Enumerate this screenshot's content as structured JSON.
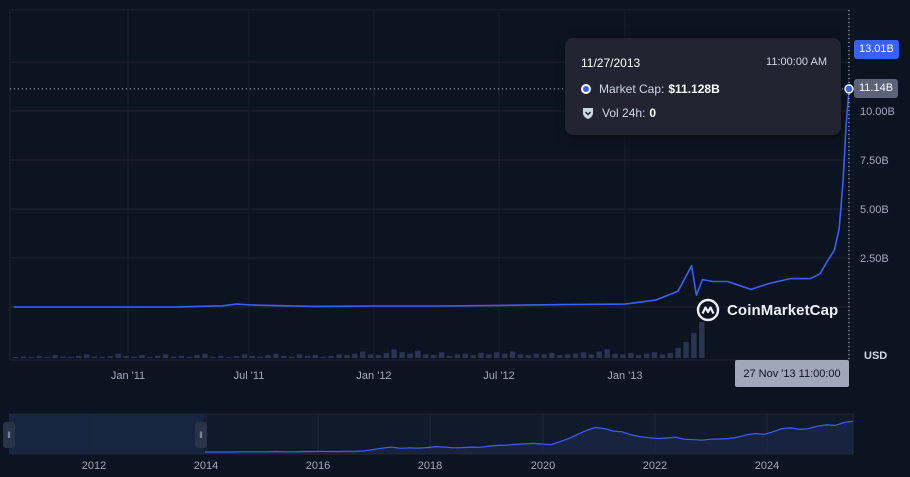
{
  "chart_data": {
    "type": "line",
    "title": "",
    "xlabel": "",
    "ylabel": "",
    "currency_label": "USD",
    "y_axis": {
      "ticks": [
        "2.50B",
        "5.00B",
        "7.50B",
        "10.00B"
      ],
      "tick_values": [
        2.5,
        5.0,
        7.5,
        10.0
      ],
      "unit": "B"
    },
    "x_axis_labels": [
      "Jan '11",
      "Jul '11",
      "Jan '12",
      "Jul '12",
      "Jan '13"
    ],
    "series": [
      {
        "name": "Market Cap",
        "unit": "B USD",
        "x": [
          "2010-07-17",
          "2010-10-01",
          "2011-01-01",
          "2011-03-15",
          "2011-05-20",
          "2011-06-10",
          "2011-07-01",
          "2011-10-01",
          "2012-01-01",
          "2012-04-01",
          "2012-07-01",
          "2012-10-01",
          "2013-01-01",
          "2013-02-15",
          "2013-03-20",
          "2013-04-09",
          "2013-04-16",
          "2013-04-25",
          "2013-05-10",
          "2013-06-01",
          "2013-07-05",
          "2013-08-01",
          "2013-09-01",
          "2013-10-01",
          "2013-10-15",
          "2013-10-25",
          "2013-11-05",
          "2013-11-12",
          "2013-11-18",
          "2013-11-22",
          "2013-11-27"
        ],
        "values": [
          0.0,
          0.001,
          0.002,
          0.006,
          0.06,
          0.15,
          0.1,
          0.03,
          0.05,
          0.05,
          0.08,
          0.12,
          0.15,
          0.35,
          0.8,
          2.1,
          0.6,
          1.4,
          1.3,
          1.3,
          0.9,
          1.2,
          1.45,
          1.45,
          1.7,
          2.3,
          2.9,
          4.0,
          6.5,
          9.2,
          11.128
        ]
      }
    ],
    "volume_24h": {
      "name": "Vol 24h",
      "values": [
        0.005,
        0.02,
        0.01,
        0.03,
        0.015,
        0.04,
        0.02,
        0.01,
        0.03,
        0.05,
        0.02,
        0.01,
        0.025,
        0.06,
        0.03,
        0.02,
        0.04,
        0.01,
        0.03,
        0.05,
        0.02,
        0.03,
        0.015,
        0.04,
        0.06,
        0.02,
        0.03,
        0.01,
        0.025,
        0.05,
        0.03,
        0.02,
        0.04,
        0.06,
        0.03,
        0.02,
        0.05,
        0.03,
        0.04,
        0.02,
        0.03,
        0.05,
        0.04,
        0.06,
        0.09,
        0.05,
        0.04,
        0.07,
        0.12,
        0.08,
        0.06,
        0.1,
        0.05,
        0.04,
        0.08,
        0.03,
        0.05,
        0.06,
        0.04,
        0.07,
        0.05,
        0.08,
        0.06,
        0.09,
        0.05,
        0.04,
        0.06,
        0.05,
        0.07,
        0.04,
        0.05,
        0.06,
        0.08,
        0.05,
        0.09,
        0.12,
        0.06,
        0.05,
        0.07,
        0.04,
        0.06,
        0.08,
        0.05,
        0.07,
        0.14,
        0.22,
        0.35,
        0.5
      ]
    },
    "navigator": {
      "x_labels": [
        "2012",
        "2014",
        "2016",
        "2018",
        "2020",
        "2022",
        "2024"
      ],
      "values": [
        0.0,
        0.0,
        0.0,
        0.0,
        0.01,
        0.01,
        0.01,
        0.01,
        0.02,
        0.01,
        0.01,
        0.02,
        0.02,
        0.03,
        0.02,
        0.02,
        0.03,
        0.03,
        0.05,
        0.1,
        0.16,
        0.2,
        0.15,
        0.17,
        0.16,
        0.18,
        0.22,
        0.2,
        0.17,
        0.18,
        0.2,
        0.19,
        0.24,
        0.27,
        0.28,
        0.31,
        0.33,
        0.35,
        0.32,
        0.3,
        0.42,
        0.55,
        0.72,
        0.88,
        1.0,
        0.95,
        0.85,
        0.82,
        0.7,
        0.62,
        0.58,
        0.55,
        0.57,
        0.6,
        0.52,
        0.5,
        0.48,
        0.52,
        0.53,
        0.55,
        0.6,
        0.7,
        0.75,
        0.72,
        0.82,
        0.95,
        0.98,
        0.92,
        0.95,
        1.05,
        1.1,
        1.08,
        1.2,
        1.25
      ]
    },
    "grid": true,
    "legend": "none"
  },
  "tooltip": {
    "date": "11/27/2013",
    "time": "11:00:00 AM",
    "market_cap_label": "Market Cap:",
    "market_cap_value": "$11.128B",
    "vol_label": "Vol 24h:",
    "vol_value": "0"
  },
  "badges": {
    "high": "13.01B",
    "current": "11.14B",
    "crosshair_date": "27 Nov '13 11:00:00"
  },
  "watermark": "CoinMarketCap",
  "colors": {
    "background": "#0d1421",
    "line": "#3861fb",
    "grid": "#222531",
    "volume": "#2b3553",
    "axis_text": "#a1a7bb"
  }
}
